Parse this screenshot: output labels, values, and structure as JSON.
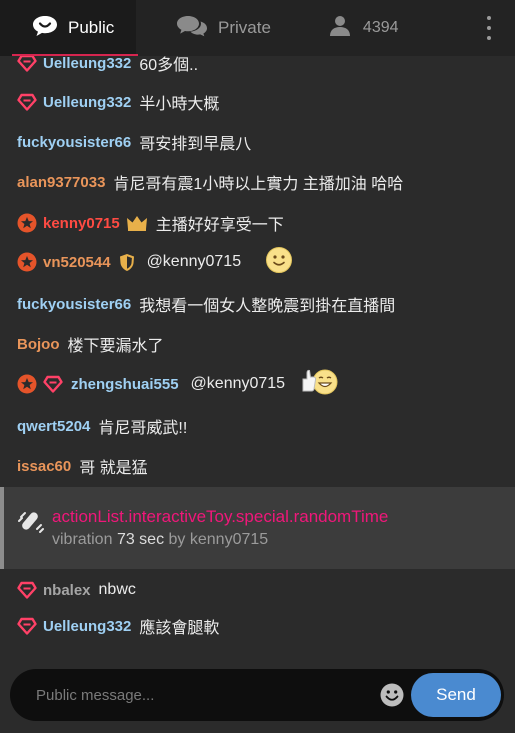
{
  "tabs": {
    "public_label": "Public",
    "private_label": "Private",
    "user_count": "4394"
  },
  "messages": [
    {
      "user": "Uelleung332",
      "text": "60多個..",
      "badges": [
        "heart-diamond"
      ],
      "user_color": "#9fd0f3"
    },
    {
      "user": "Uelleung332",
      "text": "半小時大概",
      "badges": [
        "heart-diamond"
      ],
      "user_color": "#9fd0f3"
    },
    {
      "user": "fuckyousister66",
      "text": "哥安排到早晨八",
      "badges": [],
      "user_color": "#9fd0f3"
    },
    {
      "user": "alan9377033",
      "text": "肯尼哥有震1小時以上實力 主播加油 哈哈",
      "badges": [],
      "user_color": "#e9955a"
    },
    {
      "user": "kenny0715",
      "text": "主播好好享受一下",
      "badges": [
        "star",
        "crown"
      ],
      "user_color": "#ff4b43"
    },
    {
      "user": "vn520544",
      "text": "@kenny0715",
      "badges": [
        "star",
        "shield"
      ],
      "user_color": "#e9955a",
      "emoji": "smiley"
    },
    {
      "user": "fuckyousister66",
      "text": "我想看一個女人整晚震到掛在直播間",
      "badges": [],
      "user_color": "#9fd0f3"
    },
    {
      "user": "Bojoo",
      "text": "楼下要漏水了",
      "badges": [],
      "user_color": "#e9955a"
    },
    {
      "user": "zhengshuai555",
      "text": "@kenny0715",
      "badges": [
        "star",
        "heart-diamond"
      ],
      "user_color": "#9fd0f3",
      "emoji": "thumbs-up-smiley"
    },
    {
      "user": "qwert5204",
      "text": "肯尼哥威武!!",
      "badges": [],
      "user_color": "#9fd0f3"
    },
    {
      "user": "issac60",
      "text": "哥 就是猛",
      "badges": [],
      "user_color": "#e9955a"
    }
  ],
  "action": {
    "title": "actionList.interactiveToy.special.randomTime",
    "prefix": "vibration",
    "seconds": "73 sec",
    "suffix": "by kenny0715",
    "title_color": "#f0177a"
  },
  "messages_after": [
    {
      "user": "nbalex",
      "text": "nbwc",
      "badges": [
        "heart-diamond"
      ],
      "user_color": "#a5a5a5"
    },
    {
      "user": "Uelleung332",
      "text": "應該會腿軟",
      "badges": [
        "heart-diamond"
      ],
      "user_color": "#9fd0f3"
    }
  ],
  "composer": {
    "placeholder": "Public message...",
    "send_label": "Send"
  },
  "colors": {
    "accent_red": "#d6254f",
    "send_blue": "#4a8ad0"
  }
}
